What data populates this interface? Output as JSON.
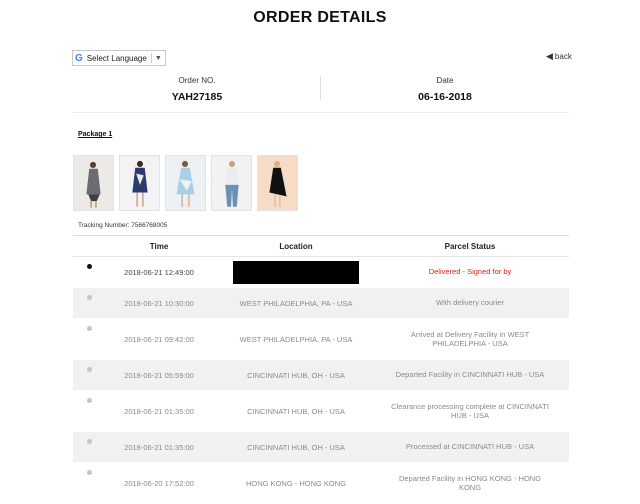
{
  "header": {
    "title": "ORDER DETAILS"
  },
  "language": {
    "label": "Select Language",
    "g": "G",
    "arrow": "▼"
  },
  "back": {
    "arrow": "◀",
    "label": "back"
  },
  "order": {
    "number_label": "Order NO.",
    "number": "YAH27185",
    "date_label": "Date",
    "date": "06-16-2018"
  },
  "package": {
    "label": "Package 1",
    "item_count": 5
  },
  "tracking": {
    "text": "Tracking Number: 7566768005"
  },
  "table": {
    "headers": {
      "time": "Time",
      "location": "Location",
      "status": "Parcel Status"
    },
    "rows": [
      {
        "time": "2018-06-21 12:49:00",
        "location": "",
        "status": "Delivered - Signed for by"
      },
      {
        "time": "2018-06-21 10:30:00",
        "location": "WEST PHILADELPHIA, PA - USA",
        "status": "With delivery courier"
      },
      {
        "time": "2018-06-21 09:42:00",
        "location": "WEST PHILADELPHIA, PA - USA",
        "status": "Arrived at Delivery Facility in WEST PHILADELPHIA - USA"
      },
      {
        "time": "2018-06-21 05:59:00",
        "location": "CINCINNATI HUB, OH - USA",
        "status": "Departed Facility in CINCINNATI HUB - USA"
      },
      {
        "time": "2018-06-21 01:35:00",
        "location": "CINCINNATI HUB, OH - USA",
        "status": "Clearance processing complete at CINCINNATI HUB - USA"
      },
      {
        "time": "2018-06-21 01:35:00",
        "location": "CINCINNATI HUB, OH - USA",
        "status": "Processed at CINCINNATI HUB - USA"
      },
      {
        "time": "2018-06-20 17:52:00",
        "location": "HONG KONG - HONG KONG",
        "status": "Departed Facility in HONG KONG - HONG KONG"
      }
    ]
  },
  "colors": {
    "delivered": "#d9231d",
    "current_dot": "#111111",
    "past_dot": "#c4c4c4",
    "row_shade": "#f1f1f1"
  }
}
